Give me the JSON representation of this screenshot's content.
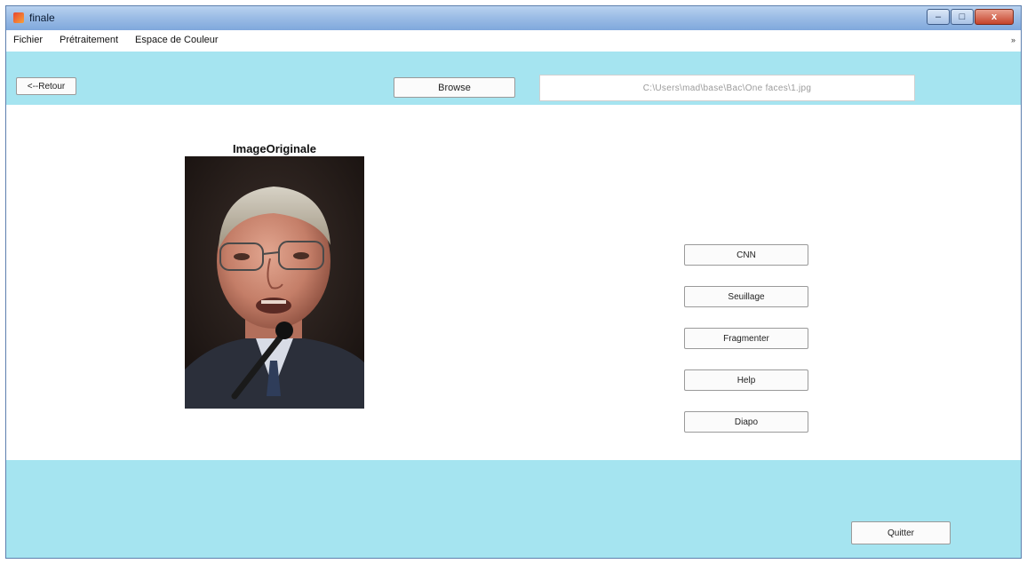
{
  "window": {
    "title": "finale",
    "minimize_glyph": "–",
    "maximize_glyph": "□",
    "close_glyph": "x"
  },
  "menu": {
    "items": [
      "Fichier",
      "Prétraitement",
      "Espace de Couleur"
    ],
    "overflow_glyph": "»"
  },
  "toolbar": {
    "back_label": "<--Retour",
    "browse_label": "Browse",
    "path_value": "C:\\Users\\mad\\base\\Bac\\One faces\\1.jpg"
  },
  "image_panel": {
    "title": "ImageOriginale",
    "image_icon": "portrait-photo"
  },
  "actions": [
    "CNN",
    "Seuillage",
    "Fragmenter",
    "Help",
    "Diapo"
  ],
  "footer": {
    "quit_label": "Quitter"
  },
  "colors": {
    "panel": "#a5e4f0",
    "titlebar": "#9cbde6",
    "content": "#ffffff"
  }
}
